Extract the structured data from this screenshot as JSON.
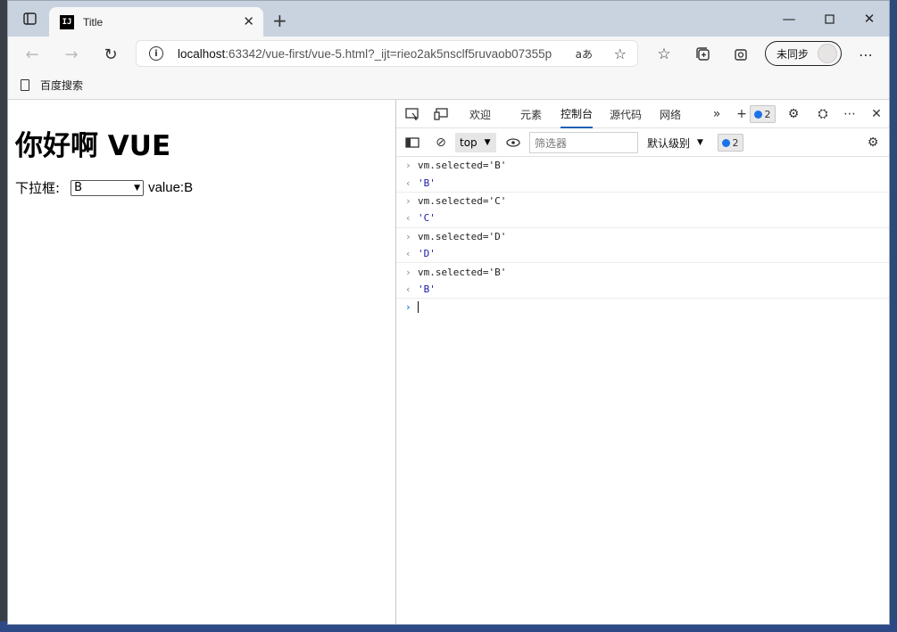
{
  "browser": {
    "tab_title": "Title",
    "tab_icon_text": "IJ",
    "url_host": "localhost",
    "url_rest": ":63342/vue-first/vue-5.html?_ijt=rieo2ak5nsclf5ruvaob07355p",
    "read_aloud_glyph": "aあ",
    "sync_label": "未同步",
    "favorites": [
      "百度搜索"
    ]
  },
  "page": {
    "heading": "你好啊 VUE",
    "select_label": "下拉框:",
    "select_value": "B",
    "value_text": "value:B"
  },
  "devtools": {
    "tabs": [
      "欢迎",
      "元素",
      "控制台",
      "源代码",
      "网络"
    ],
    "active_tab": "控制台",
    "issues_count": "2",
    "context": "top",
    "filter_placeholder": "筛选器",
    "level_label": "默认级别",
    "toolbar_issues_count": "2",
    "console_lines": [
      {
        "type": "input",
        "text": "vm.selected='B'"
      },
      {
        "type": "output",
        "text": "'B'"
      },
      {
        "type": "input",
        "text": "vm.selected='C'"
      },
      {
        "type": "output",
        "text": "'C'"
      },
      {
        "type": "input",
        "text": "vm.selected='D'"
      },
      {
        "type": "output",
        "text": "'D'"
      },
      {
        "type": "input",
        "text": "vm.selected='B'"
      },
      {
        "type": "output",
        "text": "'B'"
      }
    ]
  }
}
